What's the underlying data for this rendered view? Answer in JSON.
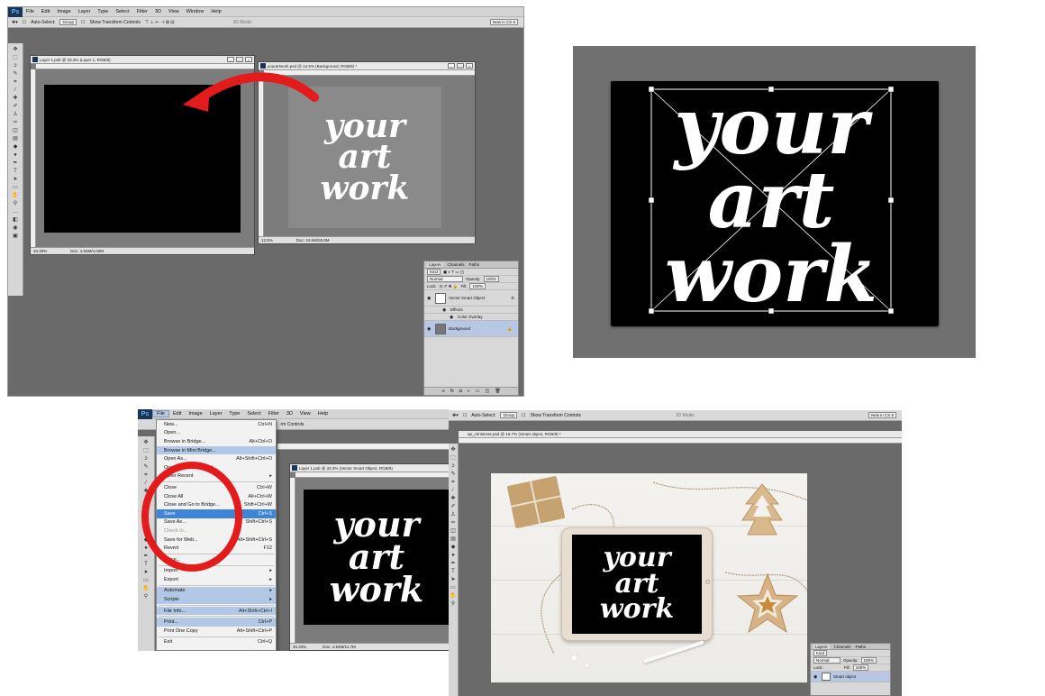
{
  "ps": {
    "logo": "Ps",
    "menu": [
      "File",
      "Edit",
      "Image",
      "Layer",
      "Type",
      "Select",
      "Filter",
      "3D",
      "View",
      "Window",
      "Help"
    ],
    "options": {
      "auto_select": "Auto-Select:",
      "group": "Group",
      "show_transform": "Show Transform Controls",
      "mode3d": "3D Mode:",
      "workspace": "New in CS 6"
    }
  },
  "panel1": {
    "doc_left": {
      "title": "Layer 1.psb @ 33.3% (Layer 1, RGB/8)",
      "zoom": "33.33%",
      "doc": "Doc: 4.52M/4.02M"
    },
    "doc_right": {
      "title": "yourartwork.psd @ 12.5% (Background, RGB/8) *",
      "zoom": "12.5%",
      "doc": "Doc: 24.6M/28.8M"
    },
    "artwork": [
      "your",
      "art",
      "work"
    ],
    "layers": {
      "tabs": [
        "Layers",
        "Channels",
        "Paths"
      ],
      "kind": "Kind",
      "blend": "Normal",
      "opacity_label": "Opacity:",
      "opacity": "100%",
      "lock_label": "Lock:",
      "fill_label": "Fill:",
      "fill": "100%",
      "layer1": "Vector Smart Object",
      "fx": "fx",
      "effects": "Effects",
      "overlay": "Color Overlay",
      "layer2": "Background"
    }
  },
  "panel2": {
    "artwork": [
      "your",
      "art",
      "work"
    ]
  },
  "panel3": {
    "menu": [
      "File",
      "Edit",
      "Image",
      "Layer",
      "Type",
      "Select",
      "Filter",
      "3D",
      "View",
      "Help"
    ],
    "transform_controls": "rm Controls",
    "doc": {
      "title": "Layer 1.psb @ 33.3% (Vector Smart Object, RGB/8)",
      "zoom": "33.33%",
      "doc": "Doc: 4.52M/11.7M"
    },
    "artwork": [
      "your",
      "art",
      "work"
    ],
    "file_menu": [
      {
        "label": "New...",
        "shortcut": "Ctrl+N",
        "state": ""
      },
      {
        "label": "Open...",
        "shortcut": "",
        "state": ""
      },
      {
        "label": "Browse in Bridge...",
        "shortcut": "Alt+Ctrl+O",
        "state": ""
      },
      {
        "label": "Browse in Mini Bridge...",
        "shortcut": "",
        "state": "hl"
      },
      {
        "label": "Open As...",
        "shortcut": "Alt+Shift+Ctrl+O",
        "state": ""
      },
      {
        "label": "Open as Smart Object...",
        "shortcut": "",
        "state": ""
      },
      {
        "label": "Open Recent",
        "shortcut": "▸",
        "state": ""
      },
      {
        "label": "",
        "shortcut": "",
        "state": "sep"
      },
      {
        "label": "Close",
        "shortcut": "Ctrl+W",
        "state": ""
      },
      {
        "label": "Close All",
        "shortcut": "Alt+Ctrl+W",
        "state": ""
      },
      {
        "label": "Close and Go to Bridge...",
        "shortcut": "Shift+Ctrl+W",
        "state": ""
      },
      {
        "label": "Save",
        "shortcut": "Ctrl+S",
        "state": "sel"
      },
      {
        "label": "Save As...",
        "shortcut": "Shift+Ctrl+S",
        "state": ""
      },
      {
        "label": "Check In...",
        "shortcut": "",
        "state": "dis"
      },
      {
        "label": "Save for Web...",
        "shortcut": "Alt+Shift+Ctrl+S",
        "state": ""
      },
      {
        "label": "Revert",
        "shortcut": "F12",
        "state": ""
      },
      {
        "label": "",
        "shortcut": "",
        "state": "sep"
      },
      {
        "label": "Place...",
        "shortcut": "",
        "state": ""
      },
      {
        "label": "",
        "shortcut": "",
        "state": "sep"
      },
      {
        "label": "Import",
        "shortcut": "▸",
        "state": ""
      },
      {
        "label": "Export",
        "shortcut": "▸",
        "state": ""
      },
      {
        "label": "",
        "shortcut": "",
        "state": "sep"
      },
      {
        "label": "Automate",
        "shortcut": "▸",
        "state": "hl"
      },
      {
        "label": "Scripts",
        "shortcut": "▸",
        "state": "hl"
      },
      {
        "label": "",
        "shortcut": "",
        "state": "sep"
      },
      {
        "label": "File Info...",
        "shortcut": "Alt+Shift+Ctrl+I",
        "state": "hl"
      },
      {
        "label": "",
        "shortcut": "",
        "state": "sep"
      },
      {
        "label": "Print...",
        "shortcut": "Ctrl+P",
        "state": "hl"
      },
      {
        "label": "Print One Copy",
        "shortcut": "Alt+Shift+Ctrl+P",
        "state": ""
      },
      {
        "label": "",
        "shortcut": "",
        "state": "sep"
      },
      {
        "label": "Exit",
        "shortcut": "Ctrl+Q",
        "state": ""
      }
    ]
  },
  "panel4": {
    "doc_title": "ap_christmas.psd @ 16.7% (Smart object, RGB/8) *",
    "artwork": [
      "your",
      "art",
      "work"
    ],
    "layers": {
      "tabs": [
        "Layers",
        "Channels",
        "Paths"
      ],
      "kind": "Kind",
      "blend": "Normal",
      "opacity_label": "Opacity:",
      "opacity": "100%",
      "lock_label": "Lock:",
      "fill_label": "Fill:",
      "fill": "100%",
      "layer1": "Smart object"
    }
  },
  "colors": {
    "arrow": "#e41b1b",
    "circle": "#e41b1b",
    "canvas_black": "#000000"
  }
}
